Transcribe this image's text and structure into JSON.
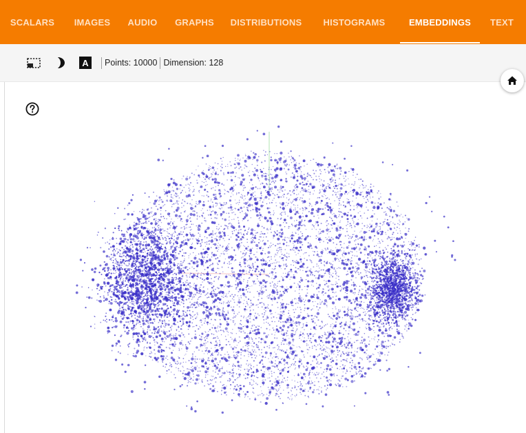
{
  "tabs": [
    {
      "label": "SCALARS",
      "active": false
    },
    {
      "label": "IMAGES",
      "active": false
    },
    {
      "label": "AUDIO",
      "active": false
    },
    {
      "label": "GRAPHS",
      "active": false
    },
    {
      "label": "DISTRIBUTIONS",
      "active": false
    },
    {
      "label": "HISTOGRAMS",
      "active": false
    },
    {
      "label": "EMBEDDINGS",
      "active": true
    },
    {
      "label": "TEXT",
      "active": false
    }
  ],
  "toolbar": {
    "icons": [
      "selection-box-icon",
      "night-mode-icon",
      "label-toggle-icon"
    ],
    "label_icon_letter": "A",
    "points_text": "Points: 10000",
    "dimension_text": "Dimension: 128"
  },
  "projection": {
    "point_color": "#3b30c8",
    "num_points": 10000,
    "dimension": 128
  },
  "colors": {
    "header": "#f57c00",
    "toolbar_bg": "#f5f5f5",
    "point": "#3b30c8"
  },
  "icons": {
    "home": "home-icon",
    "help": "help-icon"
  }
}
